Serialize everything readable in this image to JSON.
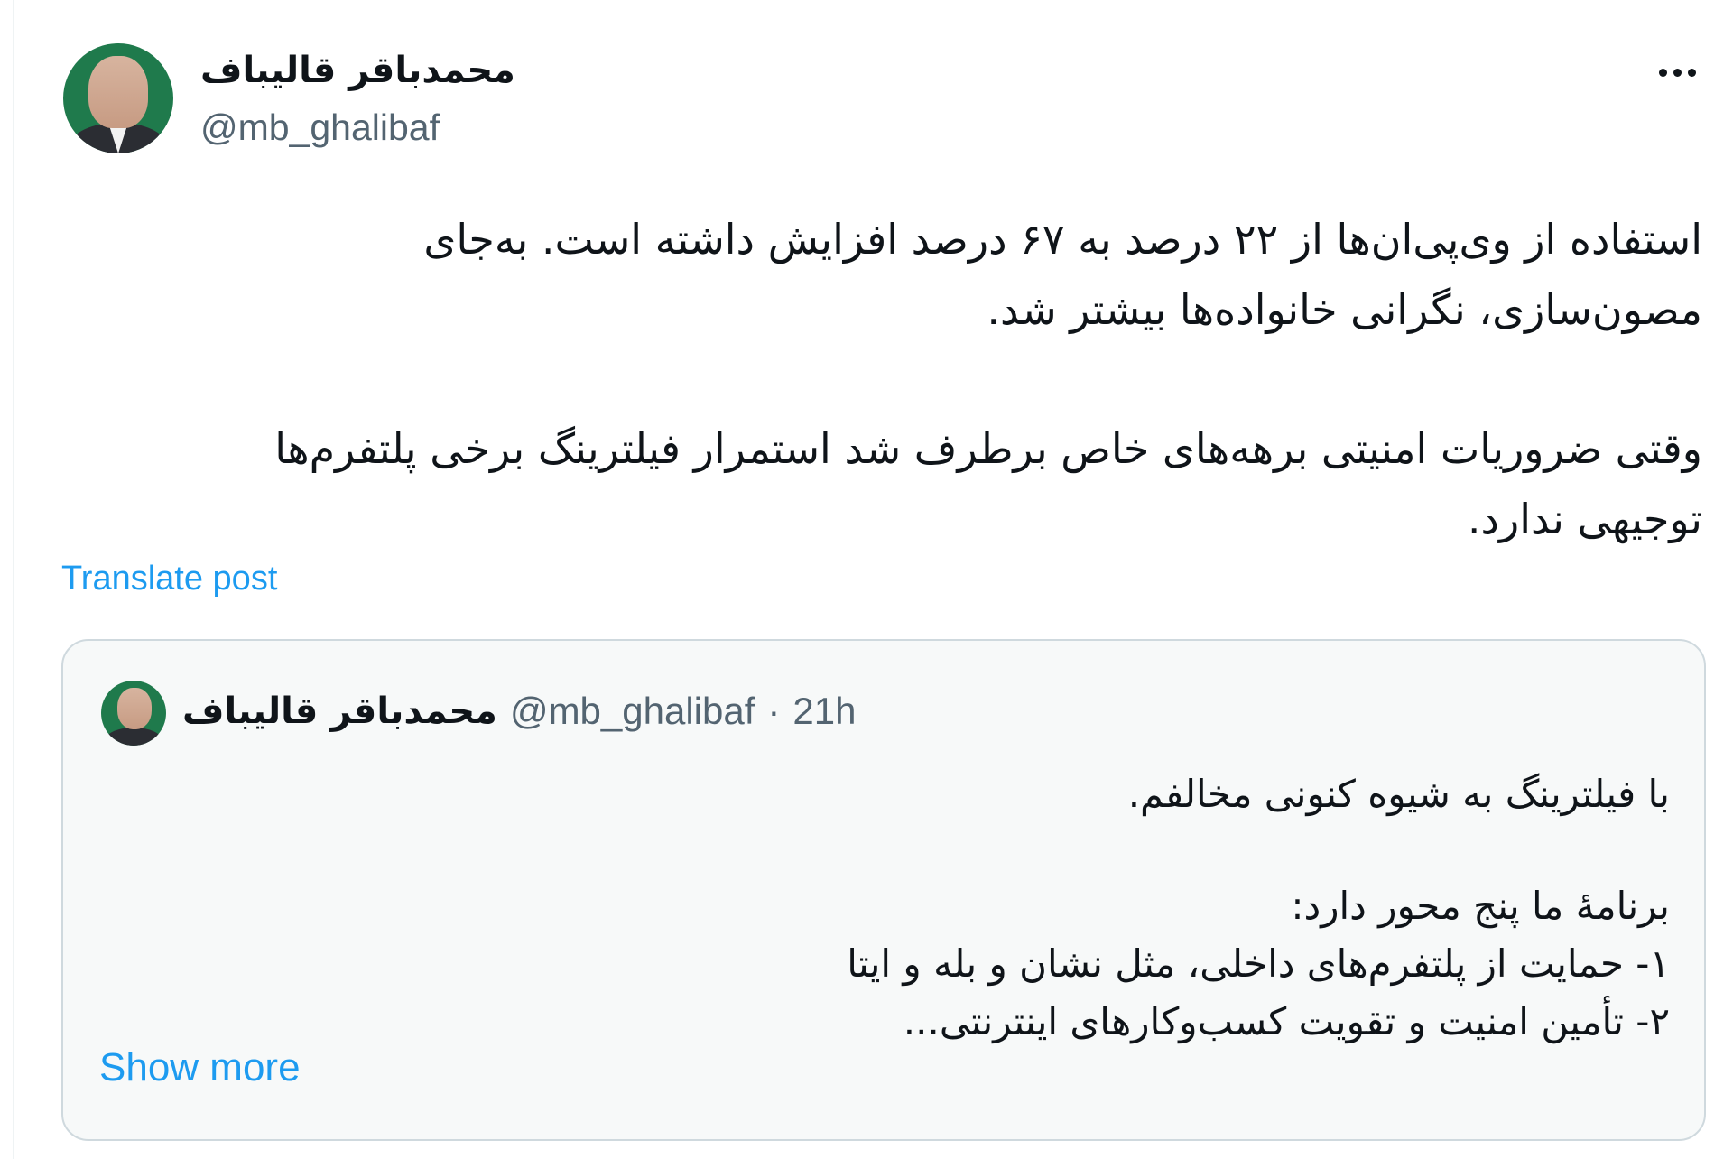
{
  "post": {
    "author_name": "محمدباقر قالیباف",
    "author_handle": "@mb_ghalibaf",
    "more_icon": "more-horizontal-icon",
    "text_paragraph_1": [
      "استفاده از وی‌پی‌ان‌ها از ۲۲ درصد به ۶۷ درصد افزایش داشته است. به‌جای",
      "مصون‌سازی، نگرانی خانواده‌ها بیشتر شد."
    ],
    "text_paragraph_2": [
      "وقتی ضروریات امنیتی برهه‌های خاص برطرف شد استمرار فیلترینگ برخی پلتفرم‌ها",
      "توجیهی ندارد."
    ],
    "translate_label": "Translate post"
  },
  "quoted_post": {
    "author_name": "محمدباقر قالیباف",
    "author_handle": "@mb_ghalibaf",
    "separator": "·",
    "time": "21h",
    "text_paragraph_1": [
      "با فیلترینگ به شیوه کنونی مخالفم."
    ],
    "text_paragraph_2": [
      "برنامۀ ما پنج محور دارد:",
      "۱- حمایت از پلتفرم‌های  داخلی، مثل نشان و بله و ایتا",
      "۲- تأمین امنیت  و تقویت کسب‌وکارهای اینترنتی..."
    ],
    "show_more_label": "Show more"
  },
  "colors": {
    "text": "#0f1419",
    "secondary": "#536471",
    "link": "#1d9bf0",
    "card_border": "#cfd9de",
    "card_bg": "#f7f9f9"
  }
}
